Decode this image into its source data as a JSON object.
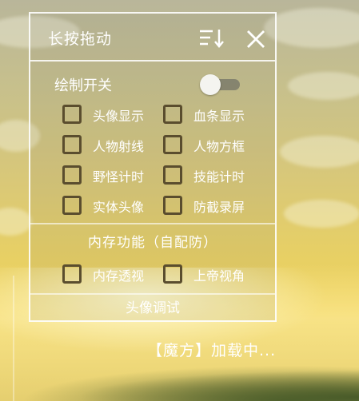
{
  "panel": {
    "title": "长按拖动",
    "sort_icon": "sort-descending-icon",
    "close_icon": "close-icon"
  },
  "draw_toggle": {
    "label": "绘制开关",
    "state": "off"
  },
  "options": [
    {
      "left": {
        "label": "头像显示",
        "checked": false
      },
      "right": {
        "label": "血条显示",
        "checked": false
      }
    },
    {
      "left": {
        "label": "人物射线",
        "checked": false
      },
      "right": {
        "label": "人物方框",
        "checked": false
      }
    },
    {
      "left": {
        "label": "野怪计时",
        "checked": false
      },
      "right": {
        "label": "技能计时",
        "checked": false
      }
    },
    {
      "left": {
        "label": "实体头像",
        "checked": false
      },
      "right": {
        "label": "防截录屏",
        "checked": false
      }
    }
  ],
  "memory_section": {
    "title": "内存功能（自配防）",
    "options": [
      {
        "label": "内存透视",
        "checked": false
      },
      {
        "label": "上帝视角",
        "checked": false
      }
    ]
  },
  "footer": {
    "label": "头像调试"
  },
  "status": {
    "loading_text": "【魔方】加载中..."
  },
  "colors": {
    "checkbox_border": "#5a4d2e",
    "text": "#ffffff"
  }
}
